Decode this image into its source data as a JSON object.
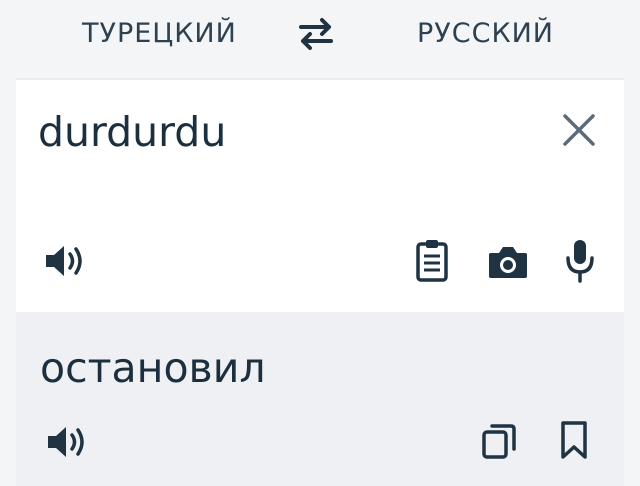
{
  "languages": {
    "source": "ТУРЕЦКИЙ",
    "target": "РУССКИЙ"
  },
  "input": {
    "text": "durdurdu"
  },
  "output": {
    "text": "остановил"
  },
  "icons": {
    "swap": "swap-arrows-icon",
    "clear": "close-icon",
    "source_speak": "speaker-icon",
    "paste": "clipboard-icon",
    "camera": "camera-icon",
    "voice": "microphone-icon",
    "target_speak": "speaker-icon",
    "copy": "copy-icon",
    "save": "bookmark-icon"
  },
  "colors": {
    "text": "#1e3140",
    "icon": "#1f3342",
    "clear_icon": "#5b6b78",
    "background": "#f4f5f7",
    "input_bg": "#ffffff",
    "output_bg": "#eef0f4"
  }
}
